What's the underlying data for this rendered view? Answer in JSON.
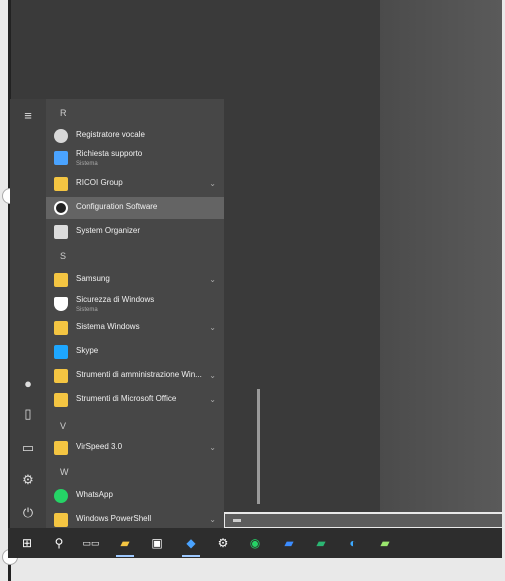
{
  "start_menu": {
    "letters": [
      "R",
      "S",
      "V",
      "W"
    ],
    "items": [
      {
        "label": "Registratore vocale",
        "icon": "microphone-icon",
        "color": "#d8d8d8"
      },
      {
        "label": "Richiesta supporto",
        "sub": "Sistema",
        "icon": "support-icon",
        "color": "#4aa3ff"
      },
      {
        "label": "RICOI Group",
        "icon": "folder-icon",
        "color": "#f4c542",
        "chev": "⌄"
      },
      {
        "label": "Configuration Software",
        "icon": "gear-icon",
        "color": "#ffffff"
      },
      {
        "label": "System Organizer",
        "icon": "organizer-icon",
        "color": "#dcdcdc"
      },
      {
        "label": "Samsung",
        "icon": "folder-icon",
        "color": "#f4c542",
        "chev": "⌄"
      },
      {
        "label": "Sicurezza di Windows",
        "sub": "Sistema",
        "icon": "shield-icon",
        "color": "#ffffff"
      },
      {
        "label": "Sistema Windows",
        "icon": "folder-icon",
        "color": "#f4c542",
        "chev": "⌄"
      },
      {
        "label": "Skype",
        "icon": "skype-icon",
        "color": "#1ea7ff"
      },
      {
        "label": "Strumenti di amministrazione Win...",
        "icon": "folder-icon",
        "color": "#f4c542",
        "chev": "⌄"
      },
      {
        "label": "Strumenti di Microsoft Office",
        "icon": "folder-icon",
        "color": "#f4c542",
        "chev": "⌄"
      },
      {
        "label": "VirSpeed 3.0",
        "icon": "folder-icon",
        "color": "#f4c542",
        "chev": "⌄"
      },
      {
        "label": "WhatsApp",
        "icon": "whatsapp-icon",
        "color": "#25d366"
      },
      {
        "label": "Windows PowerShell",
        "icon": "folder-icon",
        "color": "#f4c542",
        "chev": "⌄"
      }
    ],
    "rail_icons": [
      "hamburger-icon",
      "user-icon",
      "document-icon",
      "pictures-icon",
      "settings-icon",
      "power-icon"
    ]
  },
  "taskbar": {
    "icons": [
      "windows-start-icon",
      "search-icon",
      "task-view-icon",
      "file-explorer-icon",
      "store-icon",
      "app-icon",
      "settings-icon",
      "whatsapp-icon",
      "outlook-icon",
      "excel-icon",
      "edge-icon",
      "notepad-icon"
    ]
  }
}
